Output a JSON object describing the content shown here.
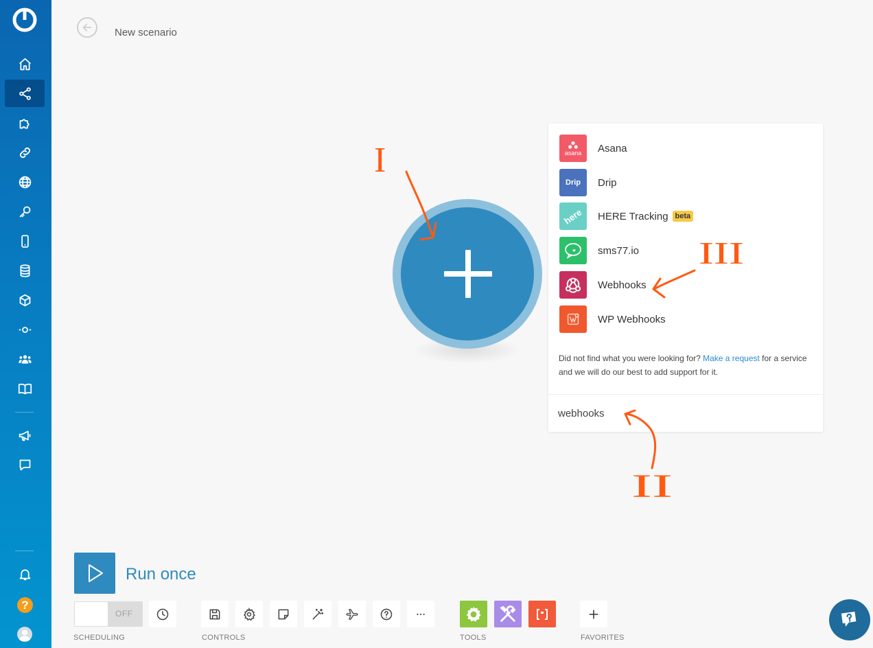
{
  "header": {
    "scenario_title": "New scenario"
  },
  "search_panel": {
    "results": [
      {
        "name": "Asana",
        "icon": "asana-icon",
        "icon_text": "asana",
        "color": "#f25a68"
      },
      {
        "name": "Drip",
        "icon": "drip-icon",
        "icon_text": "Drip",
        "color": "#4a72bd"
      },
      {
        "name": "HERE Tracking",
        "icon": "here-icon",
        "icon_text": "here",
        "color": "#6ad0c6",
        "badge": "beta"
      },
      {
        "name": "sms77.io",
        "icon": "chat-bubble-icon",
        "color": "#2cc06b"
      },
      {
        "name": "Webhooks",
        "icon": "webhooks-icon",
        "color": "#c6305e"
      },
      {
        "name": "WP Webhooks",
        "icon": "wp-webhooks-icon",
        "color": "#f0582e"
      }
    ],
    "not_found_prefix": "Did not find what you were looking for? ",
    "not_found_link": "Make a request",
    "not_found_suffix": " for a service and we will do our best to add support for it.",
    "search_value": "webhooks"
  },
  "toolbar": {
    "run_label": "Run once",
    "toggle_state": "OFF",
    "labels": {
      "scheduling": "SCHEDULING",
      "controls": "CONTROLS",
      "tools": "TOOLS",
      "favorites": "FAVORITES"
    },
    "tool_colors": {
      "flow_control": "#8dc63f",
      "tools": "#a98be8",
      "text_parser": "#f15a3a"
    }
  },
  "colors": {
    "module": "#2f8abf",
    "module_ring": "#8dc0dd",
    "annotation": "#ff5a12",
    "beta_badge": "#f7c948",
    "link": "#2a8bd0"
  },
  "annotations": {
    "label_1": "I",
    "label_2": "II",
    "label_3": "III"
  }
}
